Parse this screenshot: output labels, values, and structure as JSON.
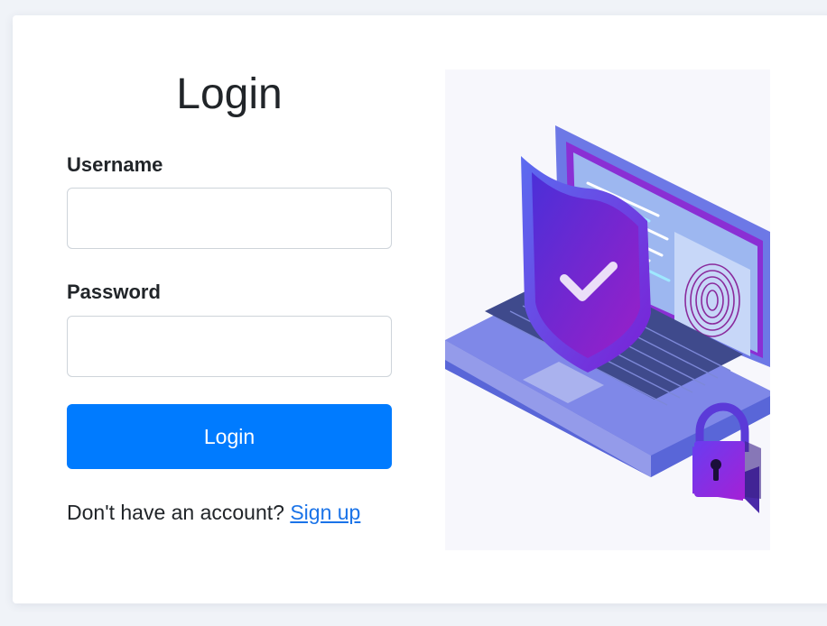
{
  "form": {
    "title": "Login",
    "username_label": "Username",
    "username_value": "",
    "password_label": "Password",
    "password_value": "",
    "submit_label": "Login",
    "signup_prompt": "Don't have an account?",
    "signup_link": "Sign up"
  },
  "colors": {
    "primary": "#007bff",
    "link": "#1a73e8",
    "page_bg": "#f0f3f8"
  },
  "illustration": {
    "icons": [
      "laptop-icon",
      "shield-check-icon",
      "fingerprint-icon",
      "padlock-icon"
    ]
  }
}
